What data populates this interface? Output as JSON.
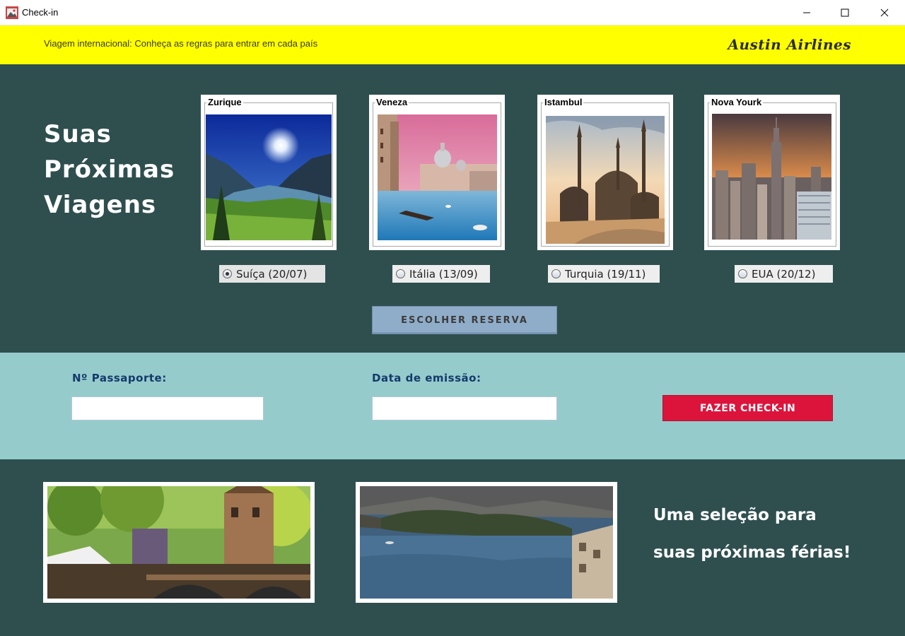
{
  "window": {
    "title": "Check-in"
  },
  "banner": {
    "text": "Viagem internacional: Conheça as regras para entrar em cada país",
    "brand": "Austin Airlines",
    "color": "#ffff00"
  },
  "top": {
    "heading": [
      "Suas",
      "Próximas",
      "Viagens"
    ],
    "destinations": [
      {
        "city": "Zurique",
        "option": "Suíça (20/07)",
        "selected": true,
        "icon": "alps-lake-photo"
      },
      {
        "city": "Veneza",
        "option": "Itália (13/09)",
        "selected": false,
        "icon": "venice-canal-photo"
      },
      {
        "city": "Istambul",
        "option": "Turquia (19/11)",
        "selected": false,
        "icon": "mosque-skyline-photo"
      },
      {
        "city": "Nova Yourk",
        "option": "EUA (20/12)",
        "selected": false,
        "icon": "manhattan-skyline-photo"
      }
    ],
    "reserve_button": "ESCOLHER RESERVA"
  },
  "form": {
    "passport_label": "Nº Passaporte:",
    "passport_value": "",
    "issue_label": "Data de emissão:",
    "issue_value": "",
    "checkin_button": "FAZER CHECK-IN",
    "checkin_color": "#dc143c"
  },
  "bottom": {
    "photos": [
      "canal-city-photo",
      "coastal-bay-photo"
    ],
    "tagline_line1": "Uma seleção para",
    "tagline_line2": "suas próximas férias!"
  },
  "colors": {
    "dark_bg": "#2f4f4f",
    "form_bg": "#96cbcc",
    "reserve_btn": "#8fadc9"
  }
}
